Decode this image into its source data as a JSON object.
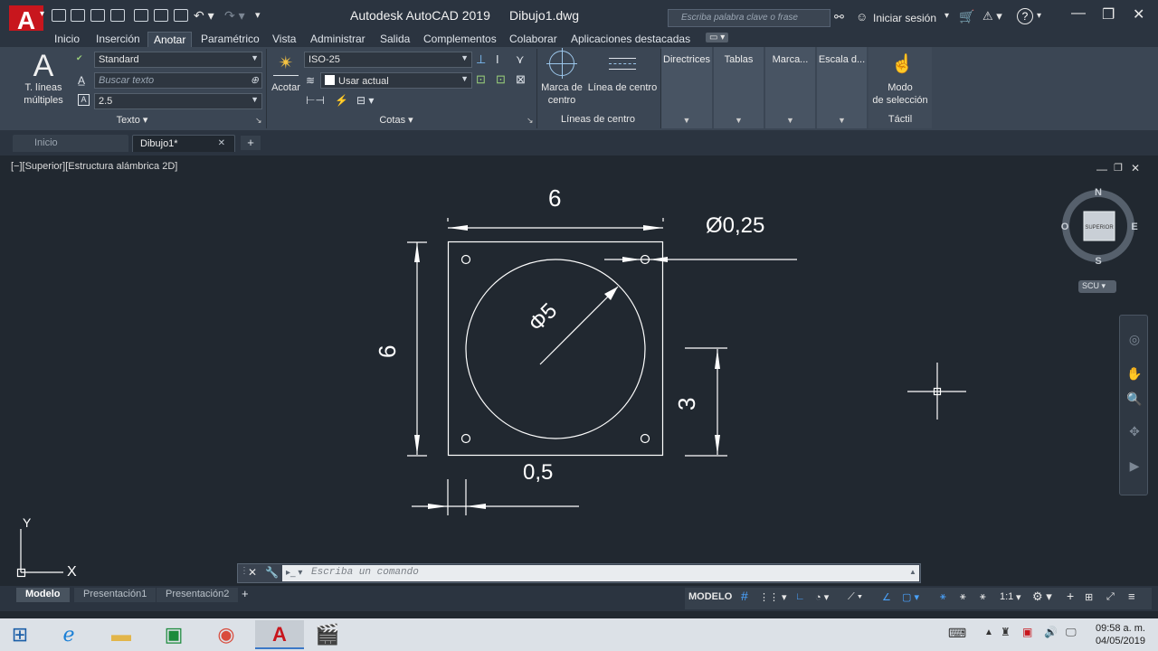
{
  "app": {
    "title": "Autodesk AutoCAD 2019",
    "document": "Dibujo1.dwg",
    "logo_letter": "A",
    "search_placeholder": "Escriba palabra clave o frase",
    "signin": "Iniciar sesión"
  },
  "ribbon_tabs": [
    "Inicio",
    "Inserción",
    "Anotar",
    "Paramétrico",
    "Vista",
    "Administrar",
    "Salida",
    "Complementos",
    "Colaborar",
    "Aplicaciones destacadas"
  ],
  "ribbon": {
    "text_panel": {
      "big_button_letter": "A",
      "big_button_label_1": "T. líneas",
      "big_button_label_2": "múltiples",
      "style_value": "Standard",
      "search_placeholder": "Buscar texto",
      "height_value": "2.5",
      "title": "Texto"
    },
    "dims_panel": {
      "acotar_label": "Acotar",
      "dimstyle_value": "ISO-25",
      "layer_value": "Usar actual",
      "title": "Cotas"
    },
    "center_panel": {
      "mark_label_1": "Marca de",
      "mark_label_2": "centro",
      "line_label": "Línea de centro",
      "title": "Líneas de centro"
    },
    "dropdowns": [
      "Directrices",
      "Tablas",
      "Marca...",
      "Escala d..."
    ],
    "touch_panel": {
      "mode_label_1": "Modo",
      "mode_label_2": "de selección",
      "title": "Táctil"
    }
  },
  "file_tabs": {
    "home": "Inicio",
    "active": "Dibujo1*"
  },
  "viewport": {
    "label": "[−][Superior][Estructura alámbrica 2D]",
    "viewcube_face": "SUPERIOR",
    "compass": {
      "n": "N",
      "s": "S",
      "e": "E",
      "w": "O"
    },
    "ucs_button": "SCU"
  },
  "drawing": {
    "dim_top": "6",
    "dim_hole": "Ø0,25",
    "dim_diam": "Φ5",
    "dim_left": "6",
    "dim_right": "3",
    "dim_bottom": "0,5",
    "axis_x": "X",
    "axis_y": "Y"
  },
  "command": {
    "placeholder": "Escriba un comando"
  },
  "layout_tabs": [
    "Modelo",
    "Presentación1",
    "Presentación2"
  ],
  "status": {
    "model": "MODELO",
    "scale": "1:1"
  },
  "clock": {
    "time": "09:58 a. m.",
    "date": "04/05/2019"
  },
  "colors": {
    "accent": "#c8161d",
    "canvas": "#212830",
    "ribbon": "#3b4654",
    "highlight": "#4aa3ff"
  }
}
